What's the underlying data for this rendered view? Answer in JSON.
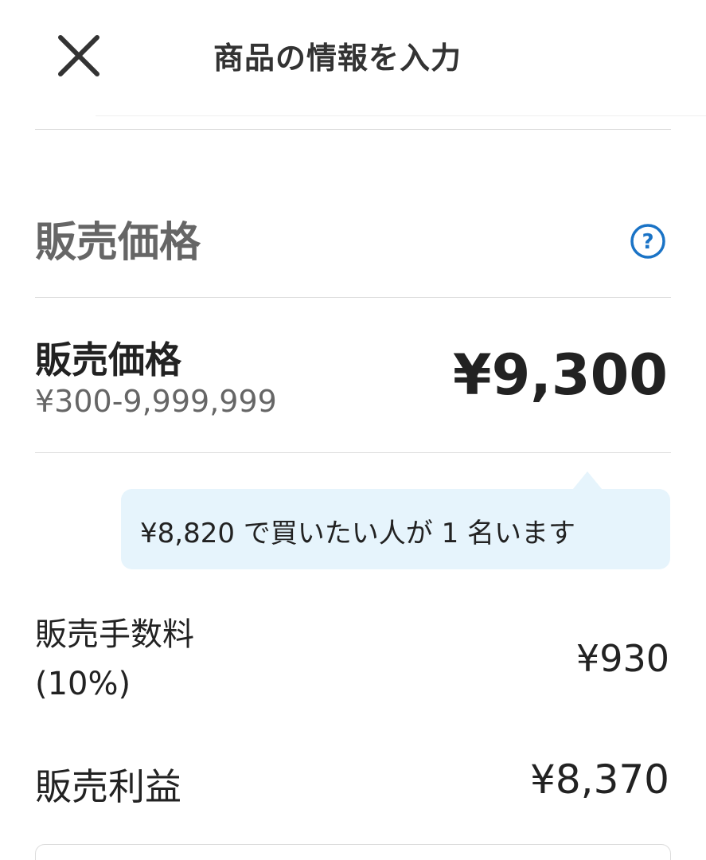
{
  "header": {
    "title": "商品の情報を入力",
    "close_icon": "close-icon"
  },
  "section": {
    "title": "販売価格",
    "help_icon": "question-circle-icon",
    "help_icon_color": "#1a73c6"
  },
  "price": {
    "label": "販売価格",
    "range": "¥300-9,999,999",
    "value": "¥9,300"
  },
  "offer_tooltip": {
    "text": "¥8,820 で買いたい人が 1 名います",
    "background": "#e6f4fc"
  },
  "fee": {
    "label_line1": "販売手数料",
    "label_line2": "(10%)",
    "value": "¥930"
  },
  "profit": {
    "label": "販売利益",
    "value": "¥8,370"
  }
}
